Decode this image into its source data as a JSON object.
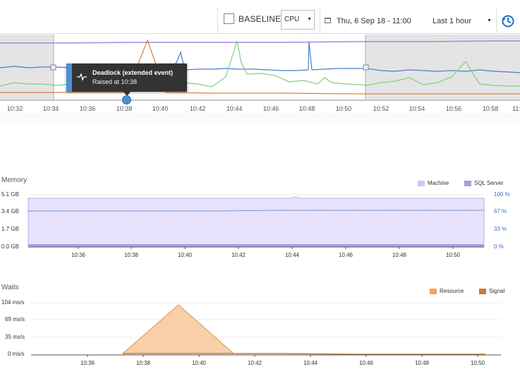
{
  "toolbar": {
    "baseline_label": "BASELINE",
    "baseline_checked": false,
    "metric_value": "CPU",
    "date_label": "Thu, 6 Sep 18 - 11:00",
    "range_value": "Last 1 hour",
    "icons": {
      "calendar": "calendar-icon",
      "history": "history-clock-icon",
      "caret": "chevron-down-icon"
    }
  },
  "overview": {
    "ticks": [
      "10:32",
      "10:34",
      "10:36",
      "10:38",
      "10:40",
      "10:42",
      "10:44",
      "10:46",
      "10:48",
      "10:50",
      "10:52",
      "10:54",
      "10:56",
      "10:58",
      "11:"
    ],
    "tooltip": {
      "title": "Deadlock (extended event)",
      "subtitle": "Raised at 10:38",
      "icon": "pulse-icon"
    },
    "colors": {
      "cpu_line": "#9b8fe0",
      "blue_line": "#4a7fcb",
      "green_line": "#7ed07e",
      "orange_line": "#d9803a",
      "selection_shade": "#e4e4e4"
    }
  },
  "memory": {
    "title": "Memory",
    "legend": [
      {
        "label": "Machine",
        "color": "#d4c6f7"
      },
      {
        "label": "SQL Server",
        "color": "#a99be0"
      }
    ],
    "y_labels": [
      "5.1 GB",
      "3.4 GB",
      "1.7 GB",
      "0.0 GB"
    ],
    "y_right_labels": [
      "100 %",
      "67 %",
      "33 %",
      "0 %"
    ],
    "x_labels": [
      "10:36",
      "10:38",
      "10:40",
      "10:42",
      "10:44",
      "10:46",
      "10:48",
      "10:50"
    ]
  },
  "waits": {
    "title": "Waits",
    "legend": [
      {
        "label": "Resource",
        "color": "#f6a45e"
      },
      {
        "label": "Signal",
        "color": "#c97a35"
      }
    ],
    "y_labels": [
      "104 ms/s",
      "69 ms/s",
      "35 ms/s",
      "0 ms/s"
    ],
    "x_labels": [
      "10:36",
      "10:38",
      "10:40",
      "10:42",
      "10:44",
      "10:46",
      "10:48",
      "10:50"
    ]
  }
}
